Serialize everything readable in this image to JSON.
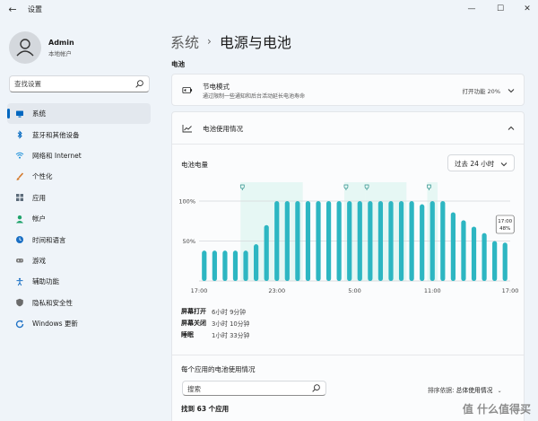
{
  "window": {
    "title": "设置",
    "controls": {
      "minimize": "—",
      "maximize": "☐",
      "close": "✕"
    }
  },
  "user": {
    "name": "Admin",
    "account": "本地帐户"
  },
  "sidebar": {
    "search_placeholder": "查找设置",
    "items": [
      {
        "label": "系统",
        "icon": "monitor-icon",
        "color": "#0067c0",
        "active": true
      },
      {
        "label": "蓝牙和其他设备",
        "icon": "bluetooth-icon",
        "color": "#0067c0"
      },
      {
        "label": "网络和 Internet",
        "icon": "wifi-icon",
        "color": "#1a8fd8"
      },
      {
        "label": "个性化",
        "icon": "brush-icon",
        "color": "#d4782a"
      },
      {
        "label": "应用",
        "icon": "apps-icon",
        "color": "#5c6b7a"
      },
      {
        "label": "帐户",
        "icon": "person-icon",
        "color": "#1fa36b"
      },
      {
        "label": "时间和语言",
        "icon": "globe-clock-icon",
        "color": "#1a6fc4"
      },
      {
        "label": "游戏",
        "icon": "gamepad-icon",
        "color": "#7a7a7a"
      },
      {
        "label": "辅助功能",
        "icon": "accessibility-icon",
        "color": "#1a6fc4"
      },
      {
        "label": "隐私和安全性",
        "icon": "shield-icon",
        "color": "#6b6b6b"
      },
      {
        "label": "Windows 更新",
        "icon": "update-icon",
        "color": "#1a6fc4"
      }
    ]
  },
  "breadcrumb": {
    "parent": "系统",
    "separator": "›",
    "current": "电源与电池"
  },
  "section": {
    "title": "电池"
  },
  "battery_saver": {
    "title": "节电模式",
    "description": "通过限制一些通知和后台活动延长电池寿命",
    "status": "打开功能 20%"
  },
  "usage": {
    "title": "电池使用情况",
    "level_label": "电池电量",
    "range": "过去 24 小时",
    "stats": [
      {
        "label": "屏幕打开",
        "value": "6小时 9分钟"
      },
      {
        "label": "屏幕关闭",
        "value": "3小时 10分钟"
      },
      {
        "label": "睡眠",
        "value": "1小时 33分钟"
      }
    ],
    "per_app_title": "每个应用的电池使用情况",
    "app_search_placeholder": "搜索",
    "sort_prefix": "排序依据:",
    "sort_value": "总体使用情况",
    "found": "找到 63 个应用"
  },
  "chart_data": {
    "type": "bar",
    "ylim": [
      0,
      100
    ],
    "yticks": [
      {
        "value": 100,
        "label": "100%"
      },
      {
        "value": 50,
        "label": "50%"
      }
    ],
    "xticks": [
      "17:00",
      "23:00",
      "5:00",
      "11:00",
      "17:00"
    ],
    "values": [
      38,
      38,
      38,
      38,
      38,
      46,
      70,
      100,
      100,
      100,
      100,
      100,
      100,
      100,
      100,
      100,
      100,
      100,
      100,
      100,
      100,
      96,
      100,
      100,
      86,
      76,
      68,
      60,
      50,
      48
    ],
    "charging_bands": [
      [
        4,
        9
      ],
      [
        14,
        15
      ],
      [
        16,
        19
      ],
      [
        22,
        22
      ]
    ],
    "charging_markers": [
      4,
      14,
      16,
      22
    ],
    "tooltip": {
      "time": "17:00",
      "value": "48%"
    },
    "bar_color": "#2db6c2",
    "band_color": "#e6f7f4"
  },
  "watermark": "值 什么值得买"
}
